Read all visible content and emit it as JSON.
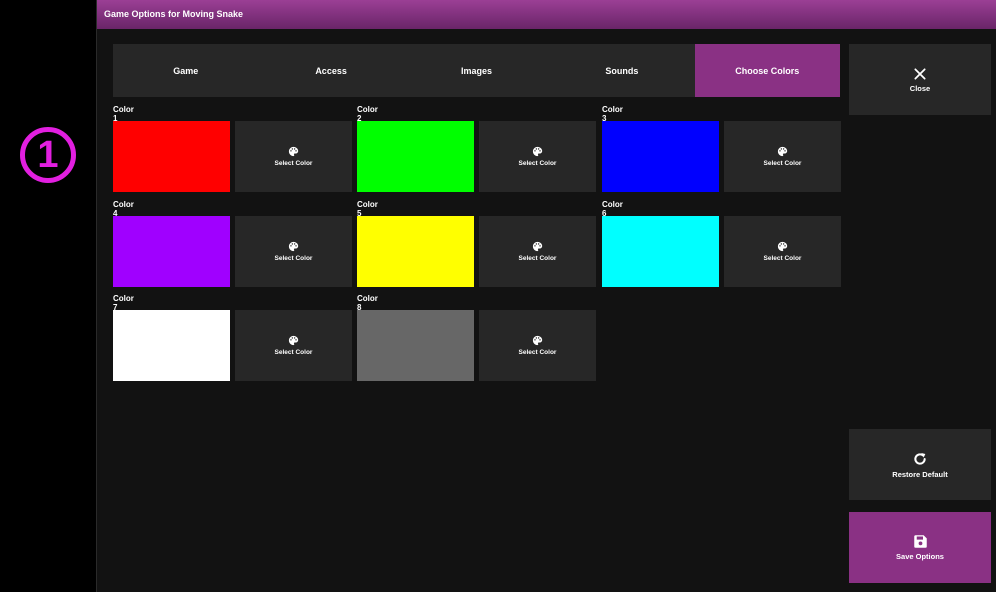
{
  "marker": {
    "number": "1"
  },
  "window": {
    "title": "Game Options for Moving Snake"
  },
  "tabs": [
    {
      "label": "Game",
      "active": false
    },
    {
      "label": "Access",
      "active": false
    },
    {
      "label": "Images",
      "active": false
    },
    {
      "label": "Sounds",
      "active": false
    },
    {
      "label": "Choose Colors",
      "active": true
    }
  ],
  "colors": [
    {
      "label": "Color 1",
      "value": "#ff0000",
      "button": "Select Color"
    },
    {
      "label": "Color 2",
      "value": "#00ff00",
      "button": "Select Color"
    },
    {
      "label": "Color 3",
      "value": "#0000ff",
      "button": "Select Color"
    },
    {
      "label": "Color 4",
      "value": "#a000ff",
      "button": "Select Color"
    },
    {
      "label": "Color 5",
      "value": "#ffff00",
      "button": "Select Color"
    },
    {
      "label": "Color 6",
      "value": "#00ffff",
      "button": "Select Color"
    },
    {
      "label": "Color 7",
      "value": "#ffffff",
      "button": "Select Color"
    },
    {
      "label": "Color 8",
      "value": "#676767",
      "button": "Select Color"
    }
  ],
  "sidebar": {
    "close_label": "Close",
    "restore_label": "Restore Default",
    "save_label": "Save Options"
  },
  "theme": {
    "accent": "#8a3184",
    "panel": "#272727",
    "background": "#121212"
  }
}
